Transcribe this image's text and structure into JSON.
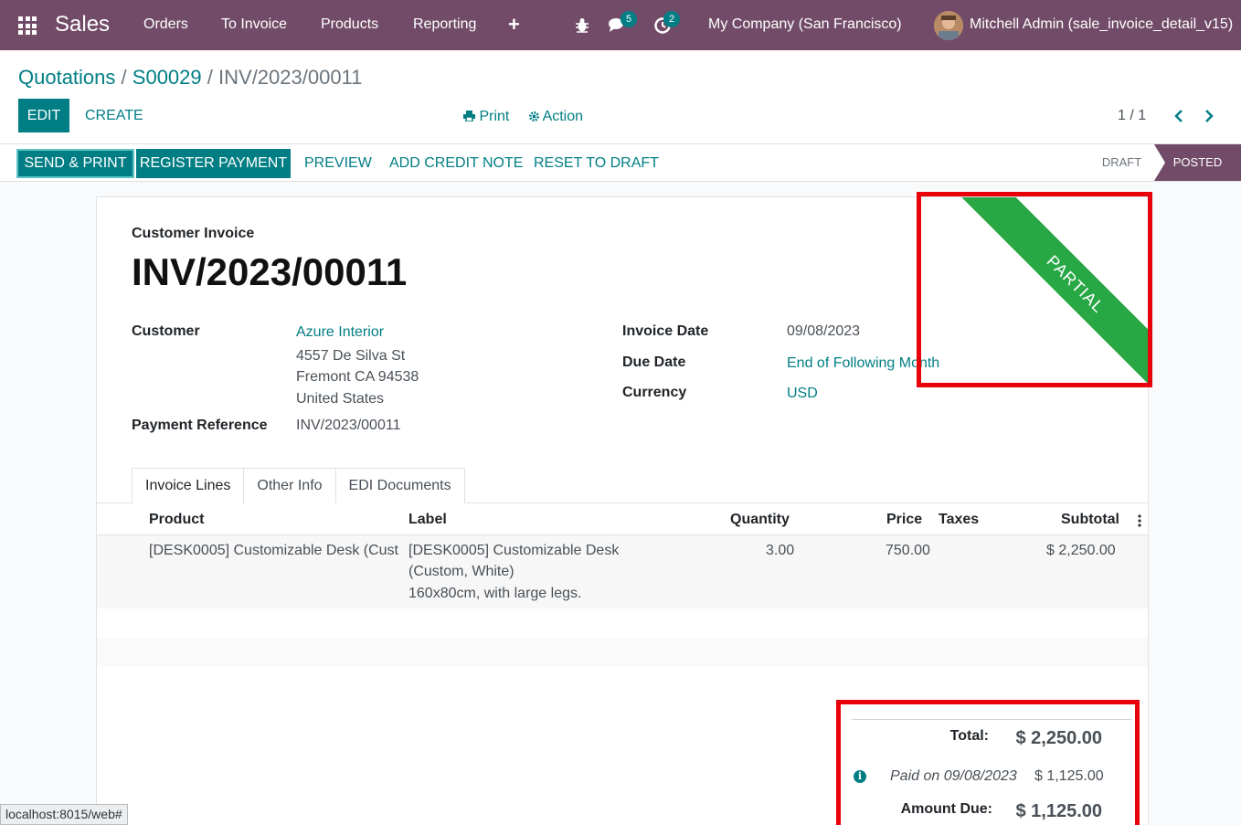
{
  "navbar": {
    "app_name": "Sales",
    "menu": [
      "Orders",
      "To Invoice",
      "Products",
      "Reporting"
    ],
    "plus_symbol": "+",
    "messages_count": "5",
    "activities_count": "2",
    "company": "My Company (San Francisco)",
    "user": "Mitchell Admin (sale_invoice_detail_v15)",
    "icons": [
      "apps-grid-icon",
      "bug-icon",
      "chat-icon",
      "clock-icon",
      "avatar"
    ]
  },
  "breadcrumb": {
    "first": "Quotations",
    "second": "S00029",
    "sep": "/",
    "current": "INV/2023/00011"
  },
  "toolbar": {
    "edit": "EDIT",
    "create": "CREATE",
    "print": "Print",
    "action": "Action",
    "pager": "1 / 1"
  },
  "statusbar": {
    "send_print": "SEND & PRINT",
    "register_payment": "REGISTER PAYMENT",
    "preview": "PREVIEW",
    "add_credit_note": "ADD CREDIT NOTE",
    "reset_to_draft": "RESET TO DRAFT",
    "stages": [
      "DRAFT",
      "POSTED"
    ],
    "active_stage": "POSTED"
  },
  "invoice": {
    "type": "Customer Invoice",
    "number": "INV/2023/00011",
    "ribbon": "PARTIAL",
    "customer_label": "Customer",
    "customer_name": "Azure Interior",
    "address": [
      "4557 De Silva St",
      "Fremont CA 94538",
      "United States"
    ],
    "payment_ref_label": "Payment Reference",
    "payment_ref": "INV/2023/00011",
    "invoice_date_label": "Invoice Date",
    "invoice_date": "09/08/2023",
    "due_date_label": "Due Date",
    "due_date": "End of Following Month",
    "currency_label": "Currency",
    "currency": "USD"
  },
  "tabs": [
    "Invoice Lines",
    "Other Info",
    "EDI Documents"
  ],
  "lines": {
    "headers": [
      "Product",
      "Label",
      "Quantity",
      "Price",
      "Taxes",
      "Subtotal"
    ],
    "rows": [
      {
        "product": "[DESK0005] Customizable Desk (Cust…",
        "label_lines": [
          "[DESK0005] Customizable Desk",
          "(Custom, White)",
          "160x80cm, with large legs."
        ],
        "quantity": "3.00",
        "price": "750.00",
        "taxes": "",
        "subtotal": "$ 2,250.00"
      }
    ]
  },
  "totals": {
    "total_label": "Total:",
    "total": "$ 2,250.00",
    "paid_label": "Paid on 09/08/2023",
    "paid_amount": "$ 1,125.00",
    "due_label": "Amount Due:",
    "due": "$ 1,125.00"
  },
  "status_url": "localhost:8015/web#",
  "colors": {
    "navbar": "#714b67",
    "primary": "#017e84",
    "ribbon": "#28a745",
    "highlight": "#e8000b"
  }
}
